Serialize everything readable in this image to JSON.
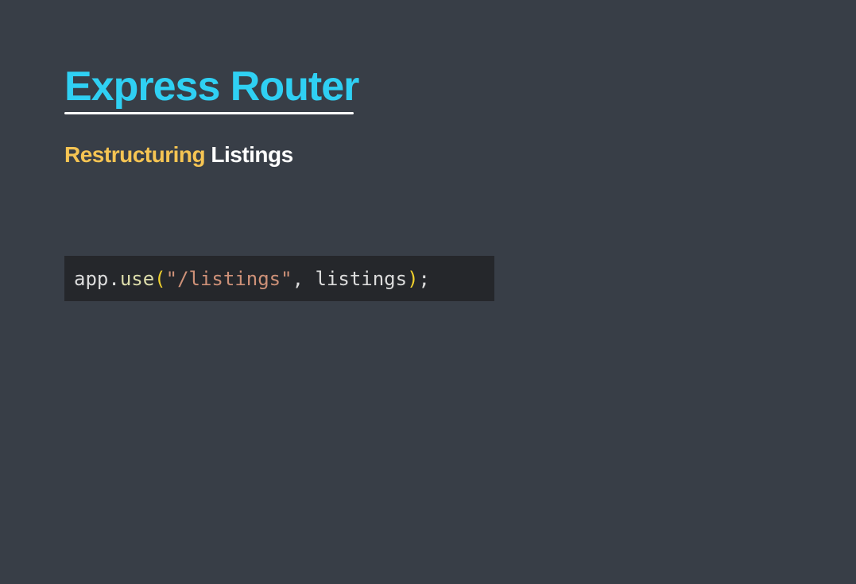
{
  "slide": {
    "title": "Express Router",
    "subtitle": {
      "accent": "Restructuring",
      "main": "Listings"
    },
    "code": {
      "object": "app",
      "dot": ".",
      "method": "use",
      "open_paren": "(",
      "string": "\"/listings\"",
      "comma": ", ",
      "argument": "listings",
      "close_paren": ")",
      "semicolon": ";"
    }
  },
  "colors": {
    "background": "#383e47",
    "title": "#2fd0f3",
    "subtitle_accent": "#f5c453",
    "subtitle_main": "#ffffff",
    "code_background": "#25272b",
    "code_string": "#ce9178",
    "code_paren": "#f0d02c"
  }
}
